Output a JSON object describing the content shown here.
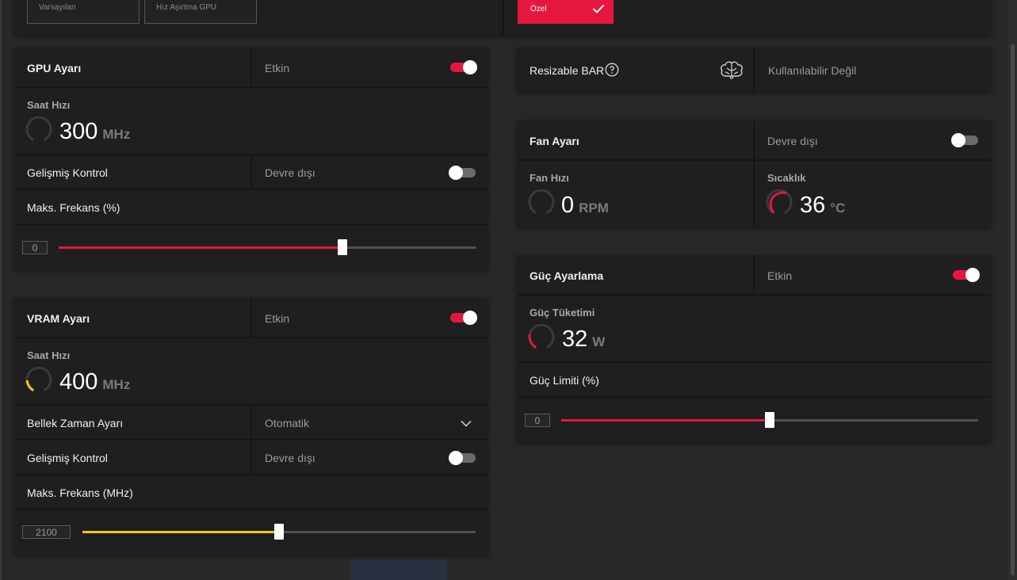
{
  "presets": {
    "default_label": "Varsayılan",
    "overclock_label": "Hız Aşırtma GPU",
    "custom_label": "Özel"
  },
  "gpu": {
    "title": "GPU Ayarı",
    "status": "Etkin",
    "enabled": true,
    "clock_title": "Saat Hızı",
    "clock_value": "300",
    "clock_unit": "MHz",
    "advanced_label": "Gelişmiş Kontrol",
    "advanced_status": "Devre dışı",
    "advanced_enabled": false,
    "max_freq_label": "Maks. Frekans (%)",
    "max_freq_box": "0",
    "slider_fraction": 0.68
  },
  "vram": {
    "title": "VRAM Ayarı",
    "status": "Etkin",
    "enabled": true,
    "clock_title": "Saat Hızı",
    "clock_value": "400",
    "clock_unit": "MHz",
    "timing_label": "Bellek Zaman Ayarı",
    "timing_value": "Otomatik",
    "advanced_label": "Gelişmiş Kontrol",
    "advanced_status": "Devre dışı",
    "advanced_enabled": false,
    "max_freq_label": "Maks. Frekans (MHz)",
    "max_freq_box": "2100",
    "slider_fraction": 0.5
  },
  "resizable_bar": {
    "label": "Resizable BAR",
    "status": "Kullanılabilir Değil"
  },
  "fan": {
    "title": "Fan Ayarı",
    "status": "Devre dışı",
    "enabled": false,
    "speed_title": "Fan Hızı",
    "speed_value": "0",
    "speed_unit": "RPM",
    "temp_title": "Sıcaklık",
    "temp_value": "36",
    "temp_unit": "°C"
  },
  "power": {
    "title": "Güç Ayarlama",
    "status": "Etkin",
    "enabled": true,
    "consumption_title": "Güç Tüketimi",
    "consumption_value": "32",
    "consumption_unit": "W",
    "limit_label": "Güç Limiti (%)",
    "limit_box": "0",
    "slider_fraction": 0.5
  },
  "colors": {
    "accent_red": "#e5173f",
    "accent_yellow": "#f5c518",
    "panel": "#1f1f1f",
    "background": "#282828"
  }
}
